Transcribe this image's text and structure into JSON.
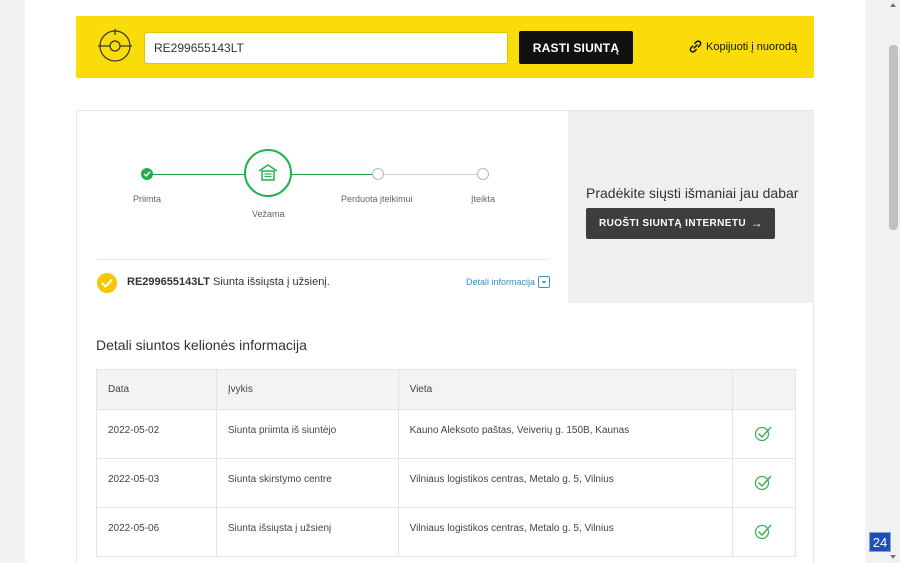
{
  "search": {
    "tracking_value": "RE299655143LT",
    "find_button": "RASTI SIUNTĄ",
    "copy_link": "Kopijuoti į nuorodą"
  },
  "steps": [
    {
      "label": "Priimta",
      "state": "done"
    },
    {
      "label": "Vežama",
      "state": "active"
    },
    {
      "label": "Perduota įteikimui",
      "state": "pending"
    },
    {
      "label": "Įteikta",
      "state": "pending"
    }
  ],
  "status": {
    "tracking_number": "RE299655143LT",
    "message": "Siunta išsiųsta į užsienį.",
    "details_link": "Detali informacija"
  },
  "promo": {
    "title": "Pradėkite siųsti išmaniai jau dabar",
    "button": "RUOŠTI SIUNTĄ INTERNETU",
    "arrow": "→"
  },
  "journey": {
    "title": "Detali siuntos kelionės informacija",
    "columns": [
      "Data",
      "Įvykis",
      "Vieta",
      ""
    ],
    "rows": [
      {
        "date": "2022-05-02",
        "event": "Siunta priimta iš siuntėjo",
        "location": "Kauno Aleksoto paštas, Veiverių g. 150B, Kaunas"
      },
      {
        "date": "2022-05-03",
        "event": "Siunta skirstymo centre",
        "location": "Vilniaus logistikos centras, Metalo g. 5, Vilnius"
      },
      {
        "date": "2022-05-06",
        "event": "Siunta išsiųsta į užsienį",
        "location": "Vilniaus logistikos centras, Metalo g. 5, Vilnius"
      }
    ]
  },
  "badge": "24",
  "colors": {
    "brand_yellow": "#fbdc0b",
    "success_green": "#1eaf48",
    "link_blue": "#3b8fc4",
    "dark_button": "#111111"
  }
}
